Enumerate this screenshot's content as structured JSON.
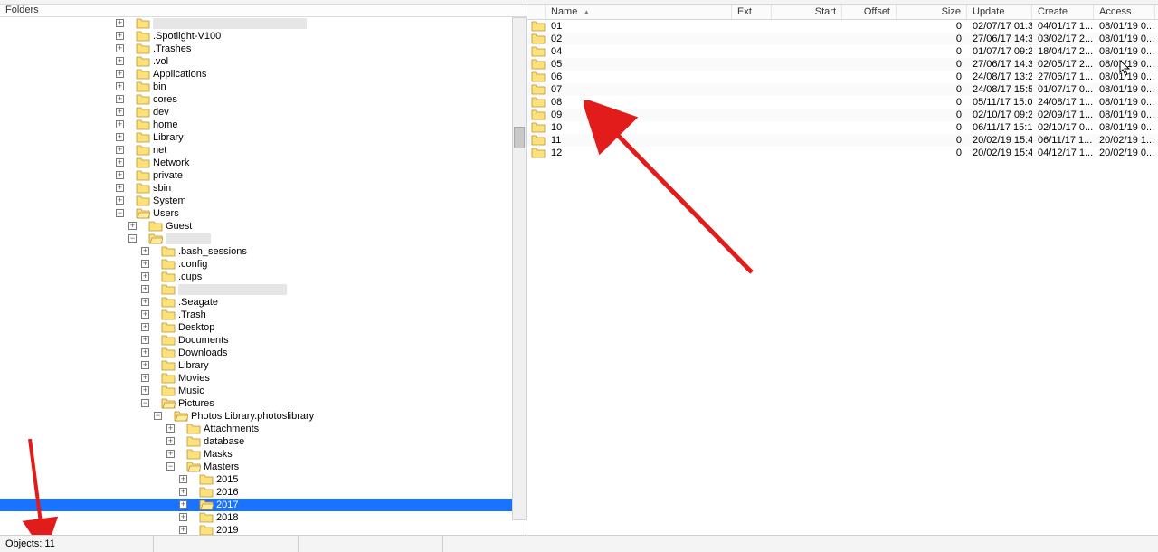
{
  "left": {
    "title": "Folders",
    "tree": [
      {
        "depth": 0,
        "exp": "plus",
        "icon": true,
        "redact": 170
      },
      {
        "depth": 0,
        "exp": "plus",
        "icon": true,
        "label": ".Spotlight-V100"
      },
      {
        "depth": 0,
        "exp": "plus",
        "icon": true,
        "label": ".Trashes"
      },
      {
        "depth": 0,
        "exp": "plus",
        "icon": true,
        "label": ".vol"
      },
      {
        "depth": 0,
        "exp": "plus",
        "icon": true,
        "label": "Applications"
      },
      {
        "depth": 0,
        "exp": "plus",
        "icon": true,
        "label": "bin"
      },
      {
        "depth": 0,
        "exp": "plus",
        "icon": true,
        "label": "cores"
      },
      {
        "depth": 0,
        "exp": "plus",
        "icon": true,
        "label": "dev"
      },
      {
        "depth": 0,
        "exp": "plus",
        "icon": true,
        "label": "home"
      },
      {
        "depth": 0,
        "exp": "plus",
        "icon": true,
        "label": "Library"
      },
      {
        "depth": 0,
        "exp": "plus",
        "icon": true,
        "label": "net"
      },
      {
        "depth": 0,
        "exp": "plus",
        "icon": true,
        "label": "Network"
      },
      {
        "depth": 0,
        "exp": "plus",
        "icon": true,
        "label": "private"
      },
      {
        "depth": 0,
        "exp": "plus",
        "icon": true,
        "label": "sbin"
      },
      {
        "depth": 0,
        "exp": "plus",
        "icon": true,
        "label": "System"
      },
      {
        "depth": 0,
        "exp": "minus",
        "icon": true,
        "label": "Users"
      },
      {
        "depth": 1,
        "exp": "plus",
        "icon": true,
        "label": "Guest"
      },
      {
        "depth": 1,
        "exp": "minus",
        "icon": true,
        "redact": 50
      },
      {
        "depth": 2,
        "exp": "plus",
        "icon": true,
        "label": ".bash_sessions"
      },
      {
        "depth": 2,
        "exp": "plus",
        "icon": true,
        "label": ".config"
      },
      {
        "depth": 2,
        "exp": "plus",
        "icon": true,
        "label": ".cups"
      },
      {
        "depth": 2,
        "exp": "plus",
        "icon": true,
        "redact": 120
      },
      {
        "depth": 2,
        "exp": "plus",
        "icon": true,
        "label": ".Seagate"
      },
      {
        "depth": 2,
        "exp": "plus",
        "icon": true,
        "label": ".Trash"
      },
      {
        "depth": 2,
        "exp": "plus",
        "icon": true,
        "label": "Desktop"
      },
      {
        "depth": 2,
        "exp": "plus",
        "icon": true,
        "label": "Documents"
      },
      {
        "depth": 2,
        "exp": "plus",
        "icon": true,
        "label": "Downloads"
      },
      {
        "depth": 2,
        "exp": "plus",
        "icon": true,
        "label": "Library"
      },
      {
        "depth": 2,
        "exp": "plus",
        "icon": true,
        "label": "Movies"
      },
      {
        "depth": 2,
        "exp": "plus",
        "icon": true,
        "label": "Music"
      },
      {
        "depth": 2,
        "exp": "minus",
        "icon": true,
        "label": "Pictures"
      },
      {
        "depth": 3,
        "exp": "minus",
        "icon": true,
        "label": "Photos Library.photoslibrary"
      },
      {
        "depth": 4,
        "exp": "plus",
        "icon": true,
        "label": "Attachments"
      },
      {
        "depth": 4,
        "exp": "plus",
        "icon": true,
        "label": "database"
      },
      {
        "depth": 4,
        "exp": "plus",
        "icon": true,
        "label": "Masks"
      },
      {
        "depth": 4,
        "exp": "minus",
        "icon": true,
        "label": "Masters"
      },
      {
        "depth": 5,
        "exp": "plus",
        "icon": true,
        "label": "2015"
      },
      {
        "depth": 5,
        "exp": "plus",
        "icon": true,
        "label": "2016"
      },
      {
        "depth": 5,
        "exp": "plus",
        "icon": true,
        "label": "2017",
        "selected": true
      },
      {
        "depth": 5,
        "exp": "plus",
        "icon": true,
        "label": "2018"
      },
      {
        "depth": 5,
        "exp": "plus",
        "icon": true,
        "label": "2019"
      }
    ]
  },
  "right": {
    "columns": {
      "name": "Name",
      "ext": "Ext",
      "start": "Start",
      "offset": "Offset",
      "size": "Size",
      "update": "Update",
      "create": "Create",
      "access": "Access"
    },
    "rows": [
      {
        "name": "01",
        "size": "0",
        "update": "02/07/17 01:3...",
        "create": "04/01/17 1...",
        "access": "08/01/19 0..."
      },
      {
        "name": "02",
        "size": "0",
        "update": "27/06/17 14:3...",
        "create": "03/02/17 2...",
        "access": "08/01/19 0..."
      },
      {
        "name": "04",
        "size": "0",
        "update": "01/07/17 09:2...",
        "create": "18/04/17 2...",
        "access": "08/01/19 0..."
      },
      {
        "name": "05",
        "size": "0",
        "update": "27/06/17 14:3...",
        "create": "02/05/17 2...",
        "access": "08/01/19 0..."
      },
      {
        "name": "06",
        "size": "0",
        "update": "24/08/17 13:2...",
        "create": "27/06/17 1...",
        "access": "08/01/19 0..."
      },
      {
        "name": "07",
        "size": "0",
        "update": "24/08/17 15:5...",
        "create": "01/07/17 0...",
        "access": "08/01/19 0..."
      },
      {
        "name": "08",
        "size": "0",
        "update": "05/11/17 15:0...",
        "create": "24/08/17 1...",
        "access": "08/01/19 0..."
      },
      {
        "name": "09",
        "size": "0",
        "update": "02/10/17 09:2...",
        "create": "02/09/17 1...",
        "access": "08/01/19 0..."
      },
      {
        "name": "10",
        "size": "0",
        "update": "06/11/17 15:1...",
        "create": "02/10/17 0...",
        "access": "08/01/19 0..."
      },
      {
        "name": "11",
        "size": "0",
        "update": "20/02/19 15:4...",
        "create": "06/11/17 1...",
        "access": "20/02/19 1..."
      },
      {
        "name": "12",
        "size": "0",
        "update": "20/02/19 15:4...",
        "create": "04/12/17 1...",
        "access": "20/02/19 0..."
      }
    ]
  },
  "status": {
    "objects_label": "Objects: 11"
  }
}
